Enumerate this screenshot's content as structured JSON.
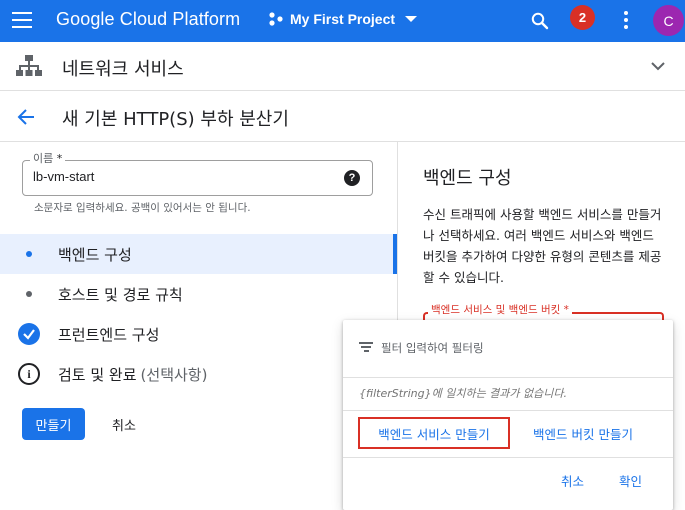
{
  "topbar": {
    "brand": "Google Cloud Platform",
    "project": "My First Project",
    "notification_count": "2",
    "avatar_initial": "C",
    "bar_color": "#1a73e8"
  },
  "section": {
    "title": "네트워크 서비스"
  },
  "page": {
    "title": "새 기본 HTTP(S) 부하 분산기"
  },
  "form": {
    "name_label": "이름",
    "name_required": "*",
    "name_value": "lb-vm-start",
    "name_hint": "소문자로 입력하세요. 공백이 있어서는 안 됩니다.",
    "help_glyph": "?",
    "steps": [
      {
        "label": "백엔드 구성",
        "state": "active"
      },
      {
        "label": "호스트 및 경로 규칙",
        "state": "pending"
      },
      {
        "label": "프런트엔드 구성",
        "state": "done"
      },
      {
        "label": "검토 및 완료",
        "optional": "(선택사항)",
        "state": "info"
      }
    ],
    "create_label": "만들기",
    "cancel_label": "취소"
  },
  "right_panel": {
    "title": "백엔드 구성",
    "description": "수신 트래픽에 사용할 백엔드 서비스를 만들거나 선택하세요. 여러 백엔드 서비스와 백엔드 버킷을 추가하여 다양한 유형의 콘텐츠를 제공할 수 있습니다.",
    "backend_label": "백엔드 서비스 및 백엔드 버킷 *",
    "error_color": "#d93025"
  },
  "dropdown": {
    "filter_placeholder": "필터 입력하여 필터링",
    "empty_message": "{filterString}에 일치하는 결과가 없습니다.",
    "create_service_label": "백엔드 서비스 만들기",
    "create_bucket_label": "백엔드 버킷 만들기",
    "cancel_label": "취소",
    "ok_label": "확인"
  },
  "icons": {
    "menu": "hamburger-menu-icon",
    "project": "project-hub-icon",
    "search": "search-icon",
    "more": "more-vert-icon",
    "network": "network-services-icon",
    "collapse": "chevron-down-icon",
    "back": "arrow-back-icon",
    "filter": "filter-list-icon",
    "help": "help-icon",
    "check": "check-circle-icon",
    "info": "info-icon"
  }
}
